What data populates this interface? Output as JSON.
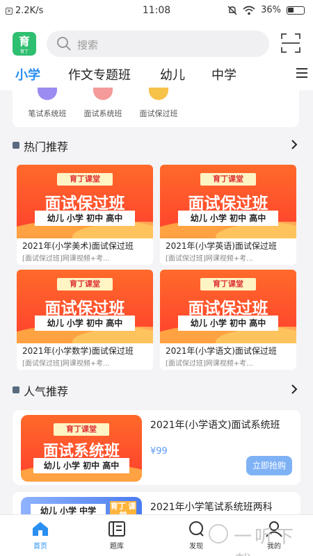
{
  "status_bar": {
    "speed": "2.2K/s",
    "time": "11:08",
    "battery": "36%"
  },
  "header": {
    "logo": {
      "char": "育",
      "sub": "育丁"
    },
    "search_placeholder": "搜索",
    "tabs": [
      "小学",
      "作文专题班",
      "幼儿",
      "中学"
    ],
    "active_tab": 0
  },
  "categories": [
    {
      "label": "笔试系统班",
      "color": "#9a8cf0"
    },
    {
      "label": "面试系统班",
      "color": "#f59a9a"
    },
    {
      "label": "面试保过班",
      "color": "#f7c24a"
    }
  ],
  "hot_section": {
    "title": "热门推荐",
    "courses": [
      {
        "brand": "育丁课堂",
        "banner_title": "面试保过班",
        "levels": "幼儿 小学 初中 高中",
        "title": "2021年(小学美术)面试保过班",
        "subtitle": "[面试保过班]网课视频+考..."
      },
      {
        "brand": "育丁课堂",
        "banner_title": "面试保过班",
        "levels": "幼儿 小学 初中 高中",
        "title": "2021年(小学英语)面试保过班",
        "subtitle": "[面试保过班]网课视频+考..."
      },
      {
        "brand": "育丁课堂",
        "banner_title": "面试保过班",
        "levels": "幼儿 小学 初中 高中",
        "title": "2021年(小学数学)面试保过班",
        "subtitle": "[面试保过班]网课视频+考..."
      },
      {
        "brand": "育丁课堂",
        "banner_title": "面试保过班",
        "levels": "幼儿 小学 初中 高中",
        "title": "2021年(小学语文)面试保过班",
        "subtitle": "[面试保过班]网课视频+考..."
      }
    ]
  },
  "popular_section": {
    "title": "人气推荐",
    "items": [
      {
        "brand": "育丁课堂",
        "banner_title": "面试系统班",
        "levels": "幼儿 小学 初中 高中",
        "title": "2021年(小学语文)面试系统班",
        "price": "¥99",
        "buy_label": "立即抢购"
      },
      {
        "levels": "幼儿 小学 中学",
        "tag": "育丁 课堂",
        "title": "2021年小学笔试系统班两科"
      }
    ]
  },
  "bottom_nav": [
    {
      "label": "首页",
      "icon": "home-icon"
    },
    {
      "label": "题库",
      "icon": "question-bank-icon"
    },
    {
      "label": "发现",
      "icon": "discover-icon"
    },
    {
      "label": "我的",
      "icon": "profile-icon"
    }
  ],
  "active_nav": 0,
  "watermark": "一听下载"
}
